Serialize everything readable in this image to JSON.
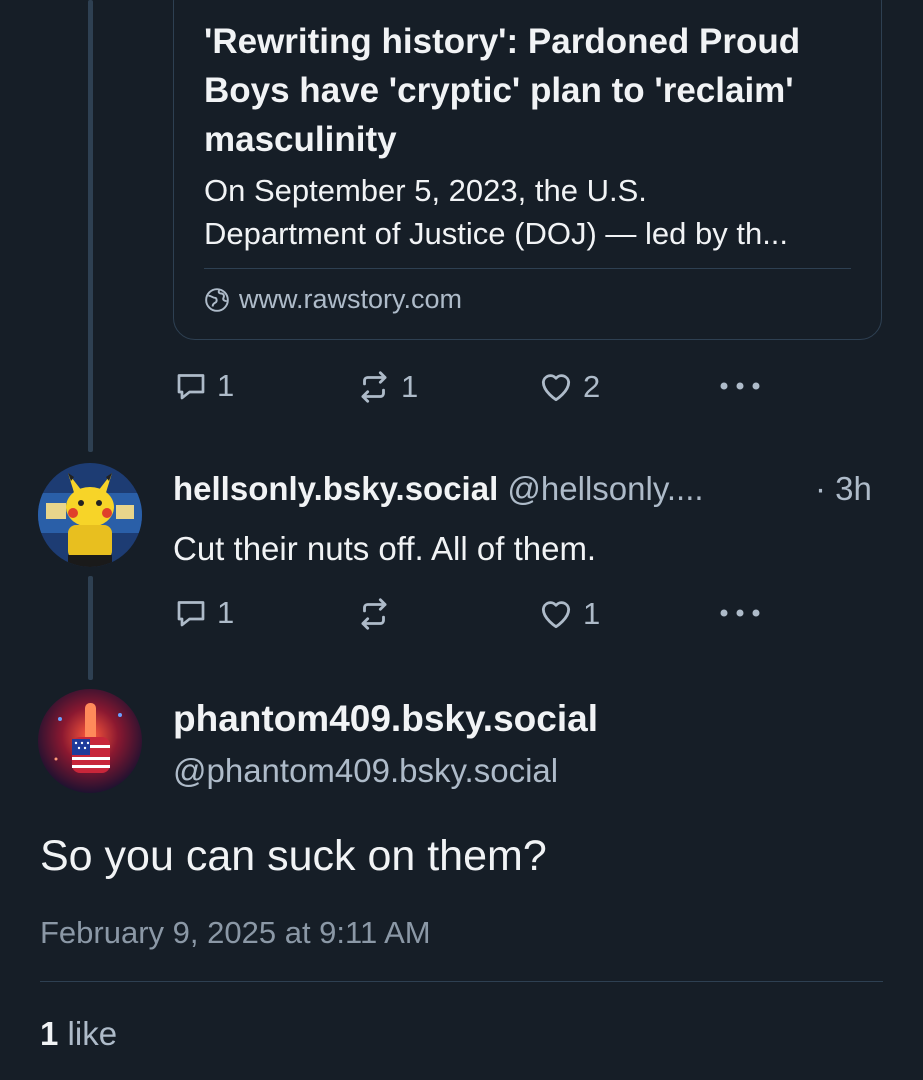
{
  "embed": {
    "title": "'Rewriting history': Pardoned Proud Boys have 'cryptic' plan to 'reclaim' masculinity",
    "description_line1": "On September 5, 2023, the U.S.",
    "description_line2": "Department of Justice (DOJ) — led by th...",
    "domain": "www.rawstory.com"
  },
  "parent_post_actions": {
    "reply_count": "1",
    "repost_count": "1",
    "like_count": "2"
  },
  "reply_post": {
    "display_name": "hellsonly.bsky.social",
    "handle": "@hellsonly....",
    "time": "· 3h",
    "text": "Cut their nuts off. All of them.",
    "reply_count": "1",
    "repost_count": "",
    "like_count": "1"
  },
  "main_post": {
    "display_name": "phantom409.bsky.social",
    "handle": "@phantom409.bsky.social",
    "text": "So you can suck on them?",
    "timestamp": "February 9, 2025 at 9:11 AM",
    "like_count": "1",
    "like_label": "like"
  },
  "colors": {
    "background": "#161e27",
    "text": "#f1f3f5",
    "muted": "#aebbc9",
    "border": "#2e4052"
  },
  "icons": [
    "reply-icon",
    "repost-icon",
    "heart-icon",
    "more-icon",
    "globe-icon"
  ]
}
